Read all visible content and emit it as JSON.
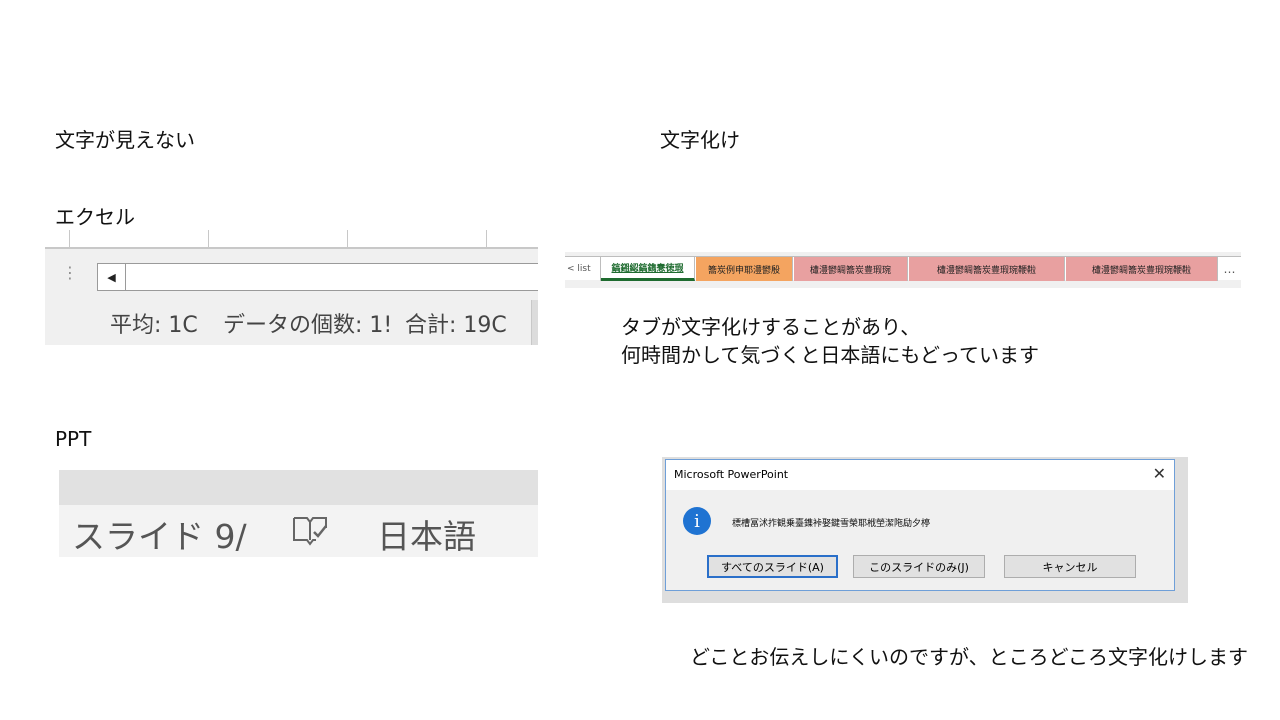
{
  "labels": {
    "left_heading": "文字が見えない",
    "right_heading": "文字化け",
    "excel_label": "エクセル",
    "ppt_label": "PPT"
  },
  "excel_statusbar": {
    "average": "平均: 1C",
    "count": "データの個数: 1!",
    "sum": "合計: 19C"
  },
  "ppt_statusbar": {
    "slide": "スライド 9/",
    "language": "日本語",
    "icon": "accessibility-check-icon"
  },
  "sheet_tabs": {
    "list_label": "< list",
    "tabs": [
      "鎬鎺綛鎬鐫惷徳瑕",
      "簥炭例申耶澧鬰殷",
      "㯾澧鬰皗簥炭豊瑕琬",
      "㯾澧鬰皗簥炭豊瑕琬鞭鞡",
      "㯾澧鬰皗簥炭豊瑕琬鞭鞡"
    ],
    "more": "…"
  },
  "tab_note": {
    "line1": "タブが文字化けすることがあり、",
    "line2": "何時間かして気づくと日本語にもどっています"
  },
  "dialog": {
    "title": "Microsoft PowerPoint",
    "message": "標槽冨沭拃観乗臺鏶裃娶鍵雪榮耶栰塋潔陁劶夕楟",
    "buttons": {
      "all_slides": "すべてのスライド(A)",
      "this_slide": "このスライドのみ(J)",
      "cancel": "キャンセル"
    }
  },
  "caption": "どことお伝えしにくいのですが、ところどころ文字化けします"
}
